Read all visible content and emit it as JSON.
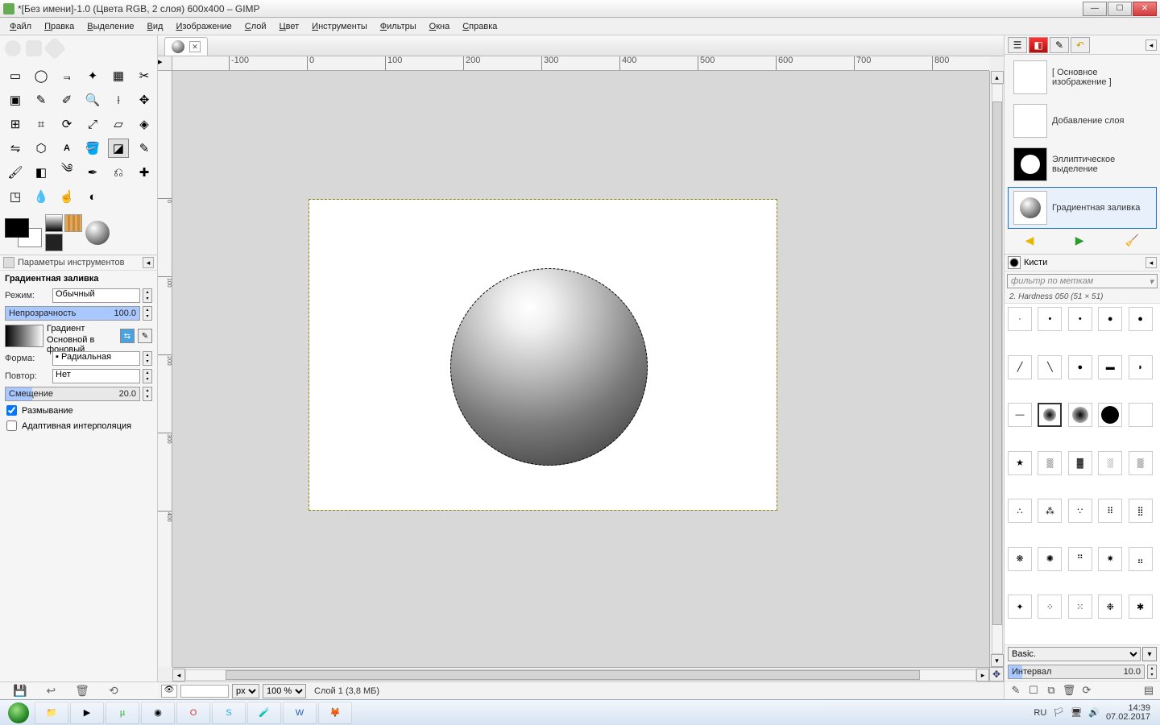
{
  "title": "*[Без имени]-1.0 (Цвета RGB, 2 слоя) 600x400 – GIMP",
  "menu": [
    "Файл",
    "Правка",
    "Выделение",
    "Вид",
    "Изображение",
    "Слой",
    "Цвет",
    "Инструменты",
    "Фильтры",
    "Окна",
    "Справка"
  ],
  "tool_options": {
    "dock_label": "Параметры инструментов",
    "title": "Градиентная заливка",
    "mode_label": "Режим:",
    "mode_value": "Обычный",
    "opacity_label": "Непрозрачность",
    "opacity_value": "100.0",
    "gradient_label": "Градиент",
    "gradient_name": "Основной в фоновый",
    "shape_label": "Форма:",
    "shape_value": "Радиальная",
    "repeat_label": "Повтор:",
    "repeat_value": "Нет",
    "offset_label": "Смещение",
    "offset_value": "20.0",
    "dither": "Размывание",
    "adaptive": "Адаптивная интерполяция"
  },
  "status": {
    "unit": "px",
    "zoom": "100 %",
    "layer": "Слой 1 (3,8 МБ)"
  },
  "journal": {
    "items": [
      {
        "label": "[ Основное изображение ]"
      },
      {
        "label": "Добавление слоя"
      },
      {
        "label": "Эллиптическое выделение"
      },
      {
        "label": "Градиентная заливка"
      }
    ]
  },
  "brushes": {
    "header": "Кисти",
    "filter_placeholder": "фильтр по меткам",
    "current": "2. Hardness 050 (51 × 51)",
    "preset": "Basic.",
    "interval_label": "Интервал",
    "interval_value": "10.0"
  },
  "ruler_h": [
    "-100",
    "0",
    "100",
    "200",
    "300",
    "400",
    "500",
    "600",
    "700",
    "800"
  ],
  "ruler_v": [
    "0",
    "100",
    "200",
    "300",
    "400"
  ],
  "tray": {
    "lang": "RU",
    "time": "14:39",
    "date": "07.02.2017"
  }
}
